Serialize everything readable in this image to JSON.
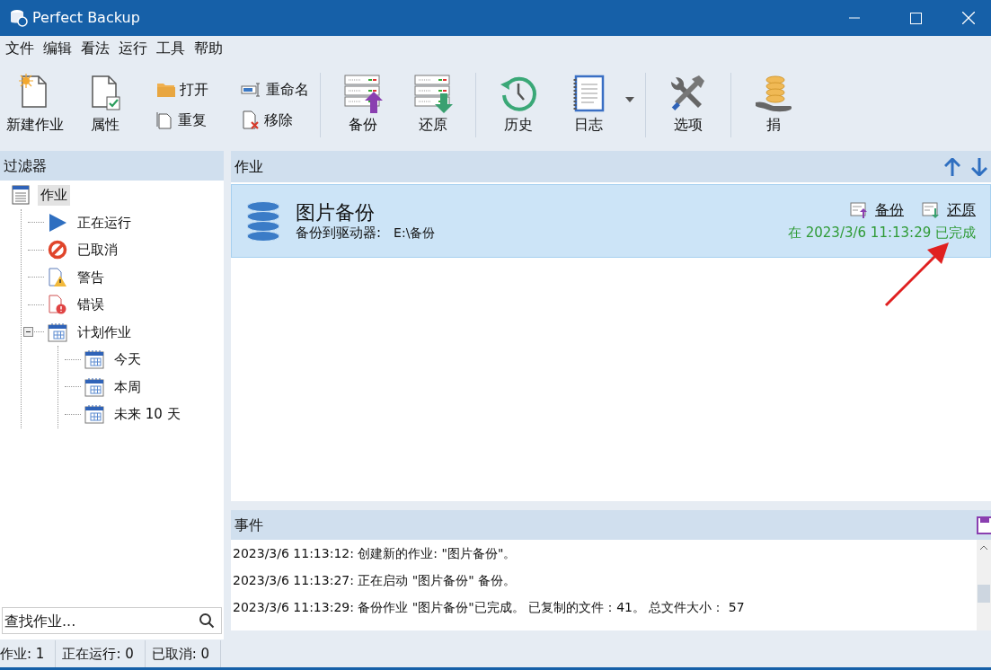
{
  "window": {
    "title": "Perfect Backup"
  },
  "menu": [
    "文件",
    "编辑",
    "看法",
    "运行",
    "工具",
    "帮助"
  ],
  "toolbar": {
    "groups": [
      [
        {
          "kind": "large",
          "label": "新建作业"
        },
        {
          "kind": "large",
          "label": "属性"
        },
        {
          "kind": "small",
          "label": "打开"
        },
        {
          "kind": "small",
          "label": "重复"
        },
        {
          "kind": "small",
          "label": "重命名"
        },
        {
          "kind": "small",
          "label": "移除"
        }
      ],
      [
        {
          "kind": "large",
          "label": "备份"
        },
        {
          "kind": "large",
          "label": "还原"
        }
      ],
      [
        {
          "kind": "large",
          "label": "历史"
        },
        {
          "kind": "dropdown",
          "label": "日志"
        }
      ],
      [
        {
          "kind": "large",
          "label": "选项"
        }
      ],
      [
        {
          "kind": "large",
          "label": "捐"
        }
      ]
    ]
  },
  "filter": {
    "title": "过滤器",
    "tree": [
      {
        "label": "作业",
        "selected": true,
        "children": [
          {
            "label": "正在运行",
            "selected": false
          },
          {
            "label": "已取消",
            "selected": false
          },
          {
            "label": "警告",
            "selected": false
          },
          {
            "label": "错误",
            "selected": false
          },
          {
            "label": "计划作业",
            "selected": false,
            "expanded": true,
            "children": [
              {
                "label": "今天",
                "selected": false
              },
              {
                "label": "本周",
                "selected": false
              },
              {
                "label": "未来 10 天",
                "selected": false
              }
            ]
          }
        ]
      }
    ],
    "search": {
      "placeholder": "查找作业..."
    }
  },
  "jobs": {
    "title": "作业",
    "items": [
      {
        "name": "图片备份",
        "destination_label": "备份到驱动器:",
        "destination": "E:\\备份",
        "actions": [
          "备份",
          "还原"
        ],
        "status": "在 2023/3/6 11:13:29 已完成",
        "selected": true
      }
    ]
  },
  "events": {
    "title": "事件",
    "items": [
      "2023/3/6 11:13:12: 创建新的作业: \"图片备份\"。",
      "2023/3/6 11:13:27: 正在启动 \"图片备份\" 备份。",
      "2023/3/6 11:13:29: 备份作业 \"图片备份\"已完成。 已复制的文件：41。 总文件大小： 57"
    ]
  },
  "status_bar": [
    "作业: 1",
    "正在运行: 0",
    "已取消: 0"
  ]
}
